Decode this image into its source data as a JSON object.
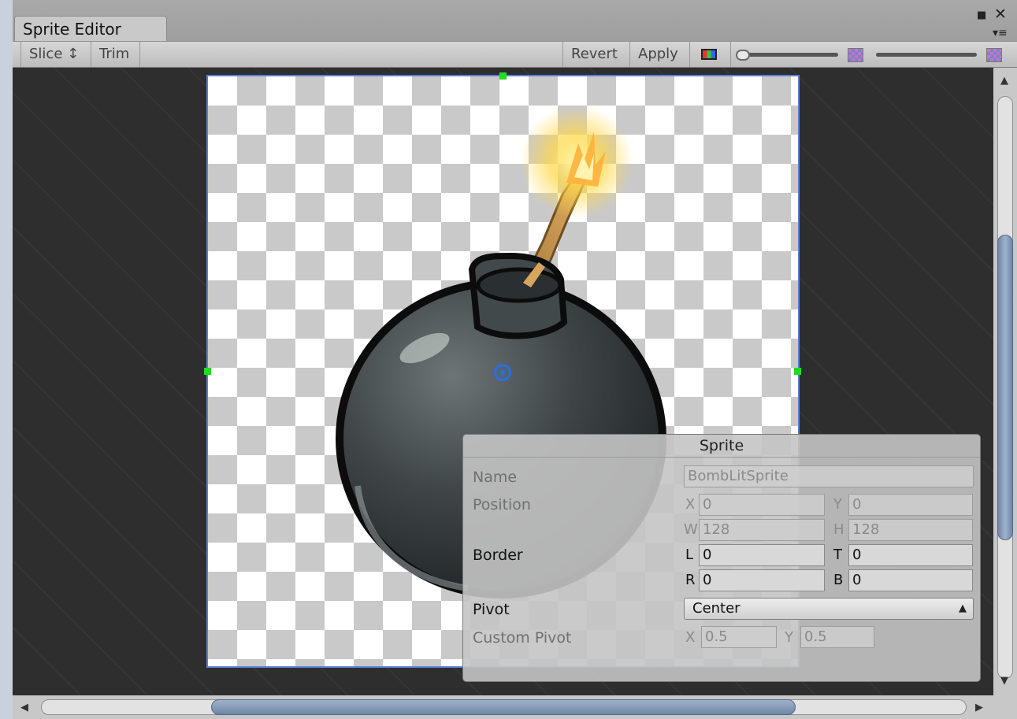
{
  "window": {
    "tab_title": "Sprite Editor",
    "maximize_icon": "maximize-icon",
    "close_icon": "close-icon",
    "menu_icon": "panel-menu-icon"
  },
  "toolbar": {
    "slice_label": "Slice ↕",
    "trim_label": "Trim",
    "revert_label": "Revert",
    "apply_label": "Apply",
    "color_channels_icon": "rgb-channels-icon",
    "mip_slider": "texture-mip-slider",
    "alpha_icon": "alpha-texture-icon",
    "zoom_slider": "zoom-slider"
  },
  "canvas": {
    "sprite_image": "bomb-lit-sprite",
    "pivot_icon": "pivot-icon"
  },
  "sprite_panel": {
    "title": "Sprite",
    "name_label": "Name",
    "name_value": "BombLitSprite",
    "position_label": "Position",
    "x_label": "X",
    "x_value": "0",
    "y_label": "Y",
    "y_value": "0",
    "w_label": "W",
    "w_value": "128",
    "h_label": "H",
    "h_value": "128",
    "border_label": "Border",
    "l_label": "L",
    "l_value": "0",
    "t_label": "T",
    "t_value": "0",
    "r_label": "R",
    "r_value": "0",
    "b_label": "B",
    "b_value": "0",
    "pivot_label": "Pivot",
    "pivot_value": "Center",
    "custom_pivot_label": "Custom Pivot",
    "cp_x_label": "X",
    "cp_x_value": "0.5",
    "cp_y_label": "Y",
    "cp_y_value": "0.5"
  },
  "colors": {
    "canvas_bg": "#2e2e2e",
    "handle": "#22dd22",
    "pivot": "#2a6fe0",
    "sprite_outline": "#5b7fd6"
  }
}
